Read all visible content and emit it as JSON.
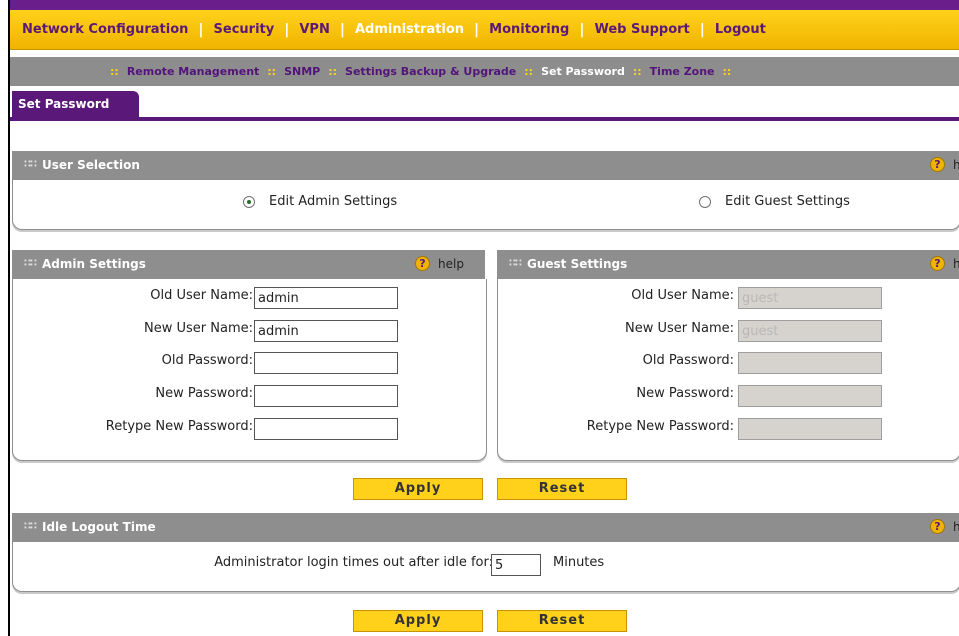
{
  "nav": {
    "items": [
      {
        "label": "Network Configuration",
        "active": false
      },
      {
        "label": "Security",
        "active": false
      },
      {
        "label": "VPN",
        "active": false
      },
      {
        "label": "Administration",
        "active": true
      },
      {
        "label": "Monitoring",
        "active": false
      },
      {
        "label": "Web Support",
        "active": false
      },
      {
        "label": "Logout",
        "active": false
      }
    ],
    "separator": "|"
  },
  "subnav": {
    "dots": "::",
    "items": [
      {
        "label": "Remote Management",
        "active": false
      },
      {
        "label": "SNMP",
        "active": false
      },
      {
        "label": "Settings Backup & Upgrade",
        "active": false
      },
      {
        "label": "Set Password",
        "active": true
      },
      {
        "label": "Time Zone",
        "active": false
      }
    ]
  },
  "tab": {
    "label": "Set Password"
  },
  "help_label": "help",
  "help_icon": "?",
  "user_selection": {
    "title": "User Selection",
    "options": [
      {
        "label": "Edit Admin Settings",
        "selected": true
      },
      {
        "label": "Edit Guest Settings",
        "selected": false
      }
    ]
  },
  "admin": {
    "title": "Admin Settings",
    "fields": [
      {
        "label": "Old User Name:",
        "value": "admin"
      },
      {
        "label": "New User Name:",
        "value": "admin"
      },
      {
        "label": "Old Password:",
        "value": ""
      },
      {
        "label": "New Password:",
        "value": ""
      },
      {
        "label": "Retype New Password:",
        "value": ""
      }
    ]
  },
  "guest": {
    "title": "Guest Settings",
    "fields": [
      {
        "label": "Old User Name:",
        "value": "guest"
      },
      {
        "label": "New User Name:",
        "value": "guest"
      },
      {
        "label": "Old Password:",
        "value": ""
      },
      {
        "label": "New Password:",
        "value": ""
      },
      {
        "label": "Retype New Password:",
        "value": ""
      }
    ]
  },
  "buttons": {
    "apply": "Apply",
    "reset": "Reset"
  },
  "idle": {
    "title": "Idle Logout Time",
    "label": "Administrator login times out after idle for:",
    "value": "5",
    "unit": "Minutes"
  },
  "colors": {
    "accent": "#5a1878",
    "nav_yellow": "#ffd11a",
    "header_gray": "#8e8e8e"
  }
}
